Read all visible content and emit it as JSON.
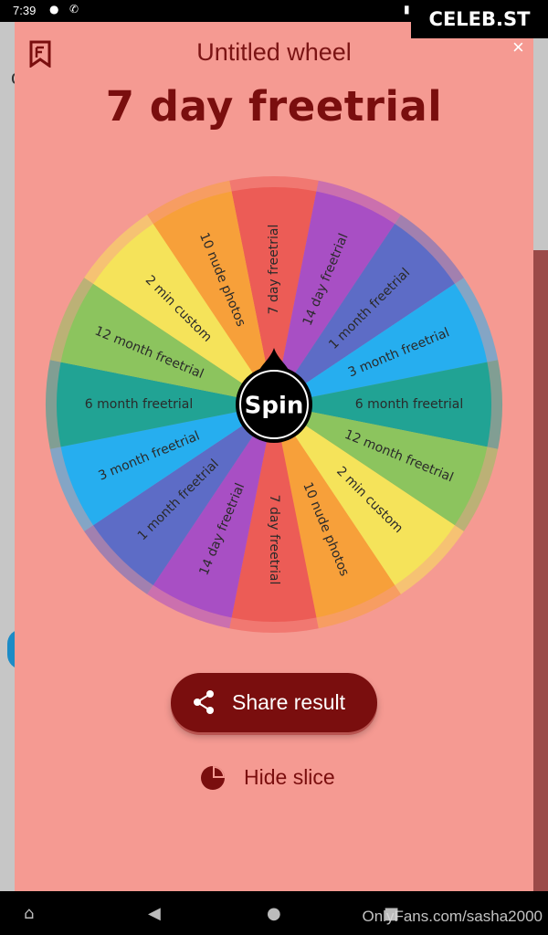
{
  "status_bar": {
    "time": "7:39"
  },
  "overlay": {
    "brand": "CELEB.ST",
    "watermark": "OnlyFans.com/sasha2000"
  },
  "modal": {
    "title": "Untitled wheel",
    "close_symbol": "×",
    "result": "7 day freetrial",
    "spin_label": "Spin",
    "share_label": "Share result",
    "hide_label": "Hide slice"
  },
  "wheel": {
    "segments": [
      {
        "label": "7 day freetrial",
        "color": "#ec5c56"
      },
      {
        "label": "14 day freetrial",
        "color": "#a84fc4"
      },
      {
        "label": "1 month freetrial",
        "color": "#5d6cc6"
      },
      {
        "label": "3 month freetrial",
        "color": "#26aeef"
      },
      {
        "label": "6 month freetrial",
        "color": "#21a394"
      },
      {
        "label": "12 month freetrial",
        "color": "#8cc45e"
      },
      {
        "label": "2 min custom",
        "color": "#f5e35a"
      },
      {
        "label": "10 nude photos",
        "color": "#f7a03a"
      },
      {
        "label": "7 day freetrial",
        "color": "#ec5c56"
      },
      {
        "label": "14 day freetrial",
        "color": "#a84fc4"
      },
      {
        "label": "1 month freetrial",
        "color": "#5d6cc6"
      },
      {
        "label": "3 month freetrial",
        "color": "#26aeef"
      },
      {
        "label": "6 month freetrial",
        "color": "#21a394"
      },
      {
        "label": "12 month freetrial",
        "color": "#8cc45e"
      },
      {
        "label": "2 min custom",
        "color": "#f5e35a"
      },
      {
        "label": "10 nude photos",
        "color": "#f7a03a"
      }
    ]
  },
  "icons": {
    "bookmark": "bookmark-icon",
    "share": "share-icon",
    "pie": "pie-chart-icon",
    "nav_home": "home-icon",
    "nav_back": "back-icon",
    "nav_home_circle": "home-circle-icon",
    "nav_recents": "recents-icon"
  }
}
